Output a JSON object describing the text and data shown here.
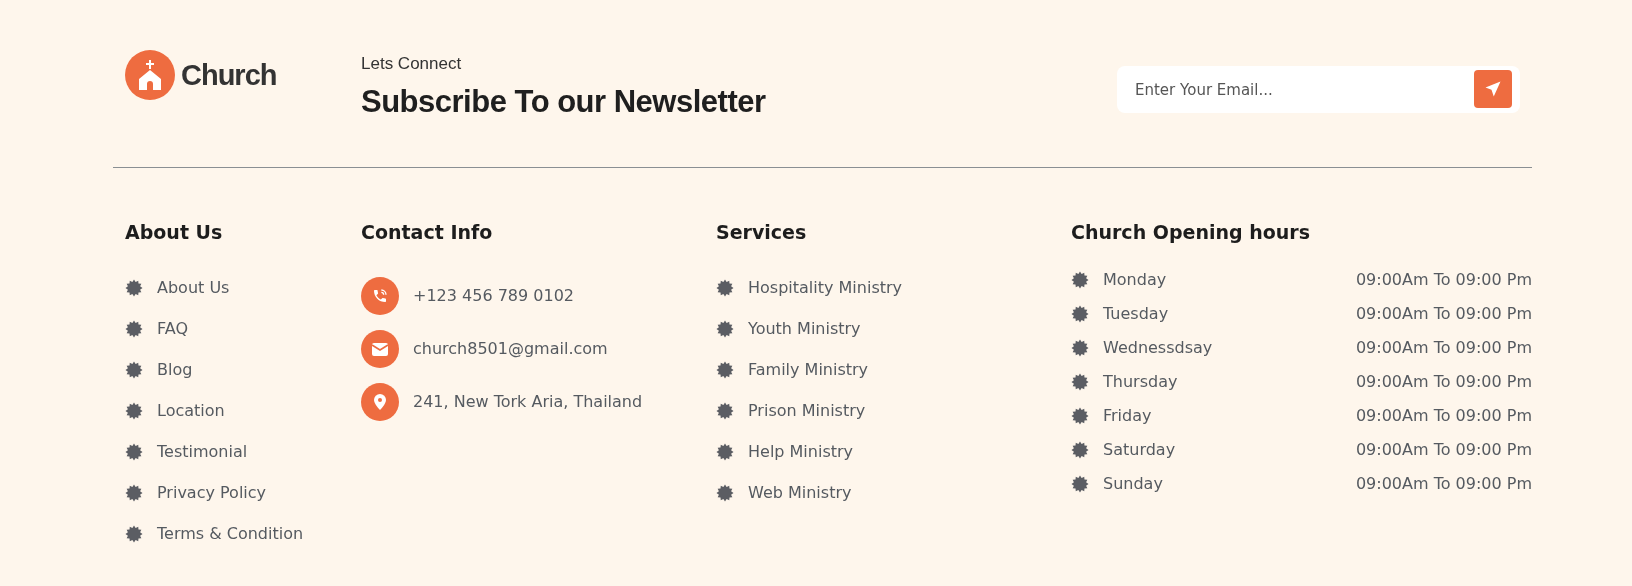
{
  "brand": {
    "name": "Church"
  },
  "newsletter": {
    "eyebrow": "Lets Connect",
    "title": "Subscribe To our Newsletter",
    "email": {
      "placeholder": "Enter Your Email..."
    }
  },
  "about": {
    "title": "About Us",
    "items": [
      "About Us",
      "FAQ",
      "Blog",
      "Location",
      "Testimonial",
      "Privacy Policy",
      "Terms & Condition"
    ]
  },
  "contact": {
    "title": "Contact Info",
    "items": [
      {
        "kind": "phone",
        "text": "+123 456 789 0102"
      },
      {
        "kind": "email",
        "text": "church8501@gmail.com"
      },
      {
        "kind": "location",
        "text": "241, New Tork Aria, Thailand"
      }
    ]
  },
  "services": {
    "title": "Services",
    "items": [
      "Hospitality Ministry",
      "Youth Ministry",
      "Family Ministry",
      "Prison Ministry",
      "Help Ministry",
      "Web Ministry"
    ]
  },
  "hours": {
    "title": "Church Opening hours",
    "rows": [
      {
        "day": "Monday",
        "time": "09:00Am To 09:00 Pm"
      },
      {
        "day": "Tuesday",
        "time": "09:00Am To 09:00 Pm"
      },
      {
        "day": "Wednessdsay",
        "time": "09:00Am To 09:00 Pm"
      },
      {
        "day": "Thursday",
        "time": "09:00Am To 09:00 Pm"
      },
      {
        "day": "Friday",
        "time": "09:00Am To 09:00 Pm"
      },
      {
        "day": "Saturday",
        "time": "09:00Am To 09:00 Pm"
      },
      {
        "day": "Sunday",
        "time": "09:00Am To 09:00 Pm"
      }
    ]
  }
}
